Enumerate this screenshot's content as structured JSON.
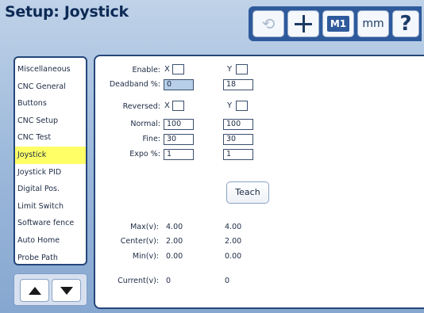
{
  "header": {
    "title": "Setup: Joystick"
  },
  "toolbar": {
    "undo_glyph": "⟲",
    "m1_label": "M1",
    "mm_label": "mm",
    "help_label": "?"
  },
  "sidebar": {
    "items": [
      {
        "label": "Miscellaneous",
        "selected": false
      },
      {
        "label": "CNC General",
        "selected": false
      },
      {
        "label": "Buttons",
        "selected": false
      },
      {
        "label": "CNC Setup",
        "selected": false
      },
      {
        "label": "CNC Test",
        "selected": false
      },
      {
        "label": "Joystick",
        "selected": true
      },
      {
        "label": "Joystick PID",
        "selected": false
      },
      {
        "label": "Digital Pos.",
        "selected": false
      },
      {
        "label": "Limit Switch",
        "selected": false
      },
      {
        "label": "Software fence",
        "selected": false
      },
      {
        "label": "Auto Home",
        "selected": false
      },
      {
        "label": "Probe Path",
        "selected": false
      }
    ],
    "selected_color": "#ffff66"
  },
  "form": {
    "enable": {
      "label": "Enable:",
      "x_label": "X",
      "y_label": "Y",
      "x_checked": false,
      "y_checked": false
    },
    "deadband": {
      "label": "Deadband %:",
      "x_value": "0",
      "y_value": "18"
    },
    "reversed": {
      "label": "Reversed:",
      "x_label": "X",
      "y_label": "Y",
      "x_checked": false,
      "y_checked": false
    },
    "normal": {
      "label": "Normal:",
      "x_value": "100",
      "y_value": "100"
    },
    "fine": {
      "label": "Fine:",
      "x_value": "30",
      "y_value": "30"
    },
    "expo": {
      "label": "Expo %:",
      "x_value": "1",
      "y_value": "1"
    },
    "teach_label": "Teach",
    "max": {
      "label": "Max(v):",
      "x_value": "4.00",
      "y_value": "4.00"
    },
    "center": {
      "label": "Center(v):",
      "x_value": "2.00",
      "y_value": "2.00"
    },
    "min": {
      "label": "Min(v):",
      "x_value": "0.00",
      "y_value": "0.00"
    },
    "current": {
      "label": "Current(v):",
      "x_value": "0",
      "y_value": "0"
    }
  },
  "colors": {
    "background": "#9db9db",
    "toolbar": "#2e5a9c",
    "title": "#0d2a55",
    "active_field": "#b8cfe9"
  }
}
